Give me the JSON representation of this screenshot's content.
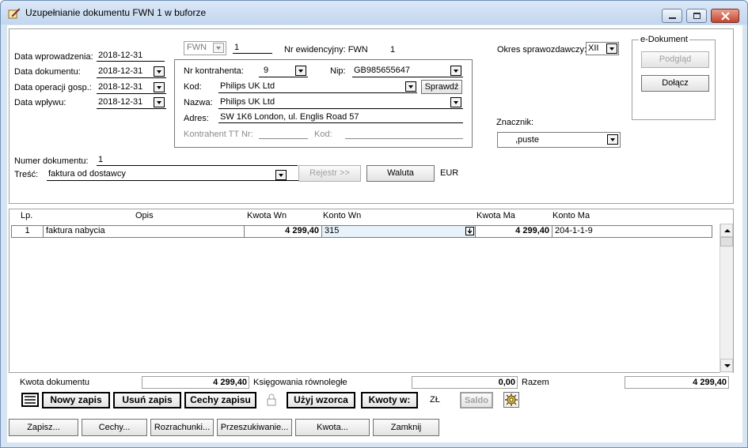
{
  "window": {
    "title": "Uzupełnianie dokumentu FWN 1 w buforze"
  },
  "header": {
    "data_wprowadzenia_label": "Data wprowadzenia:",
    "data_wprowadzenia": "2018-12-31",
    "data_dokumentu_label": "Data dokumentu:",
    "data_dokumentu": "2018-12-31",
    "data_operacji_label": "Data operacji gosp.:",
    "data_operacji": "2018-12-31",
    "data_wplywu_label": "Data wpływu:",
    "data_wplywu": "2018-12-31",
    "doc_type": "FWN",
    "doc_number": "1",
    "nr_ewidencyjny_label": "Nr ewidencyjny: FWN",
    "nr_ewidencyjny": "1",
    "okres_label": "Okres sprawozdawczy:",
    "okres_value": "XII",
    "numer_dokumentu_label": "Numer dokumentu:",
    "numer_dokumentu": "1",
    "tresc_label": "Treść:",
    "tresc_value": "faktura od dostawcy",
    "rejestr_button": "Rejestr >>",
    "waluta_button": "Waluta",
    "currency": "EUR",
    "znacznik_label": "Znacznik:",
    "znacznik_value": ",puste"
  },
  "contractor": {
    "nr_label": "Nr kontrahenta:",
    "nr_value": "9",
    "nip_label": "Nip:",
    "nip_value": "GB985655647",
    "kod_label": "Kod:",
    "kod_value": "Philips UK Ltd",
    "sprawdz_button": "Sprawdź",
    "nazwa_label": "Nazwa:",
    "nazwa_value": "Philips UK Ltd",
    "adres_label": "Adres:",
    "adres_value": "SW 1K6 London, ul. Englis Road 57",
    "tt_label": "Kontrahent TT Nr:",
    "tt_kod_label": "Kod:"
  },
  "edokument": {
    "group_label": "e-Dokument",
    "podglad_button": "Podgląd",
    "dolacz_button": "Dołącz"
  },
  "grid": {
    "columns": [
      "Lp.",
      "Opis",
      "Kwota Wn",
      "Konto Wn",
      "Kwota Ma",
      "Konto Ma"
    ],
    "rows": [
      {
        "lp": "1",
        "opis": "faktura nabycia",
        "kwota_wn": "4 299,40",
        "konto_wn": "315",
        "kwota_ma": "4 299,40",
        "konto_ma": "204-1-1-9"
      }
    ]
  },
  "summary": {
    "kwota_dokumentu_label": "Kwota dokumentu",
    "kwota_dokumentu": "4 299,40",
    "ksiegowania_label": "Księgowania równoległe",
    "ksiegowania_value": "0,00",
    "razem_label": "Razem",
    "razem_value": "4 299,40"
  },
  "toolbar": {
    "nowy_zapis": "Nowy zapis",
    "usun_zapis": "Usuń zapis",
    "cechy_zapisu": "Cechy zapisu",
    "uzyj_wzorca": "Użyj wzorca",
    "kwoty_w": "Kwoty w:",
    "currency_zl": "ZŁ",
    "saldo": "Saldo"
  },
  "bottom_buttons": {
    "zapisz": "Zapisz...",
    "cechy": "Cechy...",
    "rozrachunki": "Rozrachunki...",
    "przeszukiwanie": "Przeszukiwanie...",
    "kwota": "Kwota...",
    "zamknij": "Zamknij"
  },
  "colors": {
    "window_frame": "#d7e4f2",
    "close_button": "#c5452e",
    "selected_cell": "#e8f2fb"
  }
}
